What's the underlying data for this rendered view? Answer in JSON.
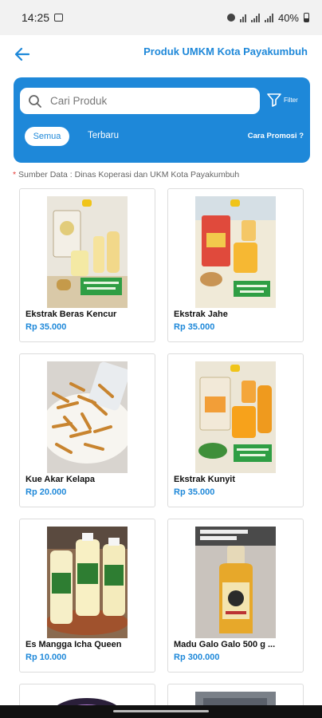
{
  "status_bar": {
    "time": "14:25",
    "battery": "40%"
  },
  "header": {
    "title": "Produk UMKM Kota Payakumbuh"
  },
  "search": {
    "placeholder": "Cari Produk"
  },
  "filter": {
    "label": "Filter"
  },
  "tabs": [
    {
      "label": "Semua"
    },
    {
      "label": "Terbaru"
    }
  ],
  "promo_link": "Cara Promosi ?",
  "source_note": {
    "asterisk": "*",
    "text": " Sumber Data : Dinas Koperasi dan UKM Kota Payakumbuh"
  },
  "products": [
    {
      "name": "Ekstrak Beras Kencur",
      "price": "Rp 35.000"
    },
    {
      "name": "Ekstrak Jahe",
      "price": "Rp 35.000"
    },
    {
      "name": "Kue Akar Kelapa",
      "price": "Rp 20.000"
    },
    {
      "name": "Ekstrak Kunyit",
      "price": "Rp 35.000"
    },
    {
      "name": "Es Mangga Icha Queen",
      "price": "Rp 10.000"
    },
    {
      "name": "Madu Galo Galo 500 g ...",
      "price": "Rp 300.000"
    }
  ],
  "colors": {
    "accent": "#1e88d9"
  }
}
